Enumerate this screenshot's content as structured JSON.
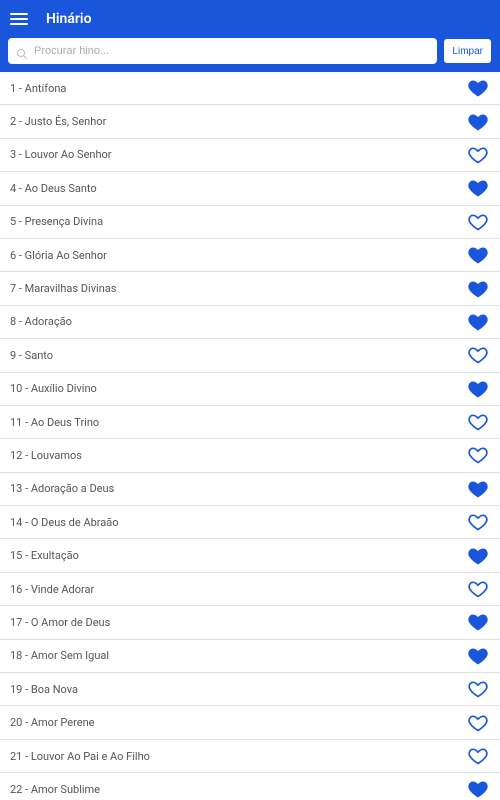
{
  "header": {
    "title": "Hinário"
  },
  "search": {
    "placeholder": "Procurar hino...",
    "clear_label": "Limpar"
  },
  "colors": {
    "primary": "#1a56db"
  },
  "hymns": [
    {
      "num": 1,
      "title": "Antífona",
      "fav": true
    },
    {
      "num": 2,
      "title": "Justo És, Senhor",
      "fav": true
    },
    {
      "num": 3,
      "title": "Louvor Ao Senhor",
      "fav": false
    },
    {
      "num": 4,
      "title": "Ao Deus Santo",
      "fav": true
    },
    {
      "num": 5,
      "title": "Presença Divina",
      "fav": false
    },
    {
      "num": 6,
      "title": "Glória Ao Senhor",
      "fav": true
    },
    {
      "num": 7,
      "title": "Maravilhas Divinas",
      "fav": true
    },
    {
      "num": 8,
      "title": "Adoração",
      "fav": true
    },
    {
      "num": 9,
      "title": "Santo",
      "fav": false
    },
    {
      "num": 10,
      "title": "Auxílio Divino",
      "fav": true
    },
    {
      "num": 11,
      "title": "Ao Deus Trino",
      "fav": false
    },
    {
      "num": 12,
      "title": "Louvamos",
      "fav": false
    },
    {
      "num": 13,
      "title": "Adoração a Deus",
      "fav": true
    },
    {
      "num": 14,
      "title": "O Deus de Abraão",
      "fav": false
    },
    {
      "num": 15,
      "title": "Exultação",
      "fav": true
    },
    {
      "num": 16,
      "title": "Vinde Adorar",
      "fav": false
    },
    {
      "num": 17,
      "title": "O Amor de Deus",
      "fav": true
    },
    {
      "num": 18,
      "title": "Amor Sem Igual",
      "fav": true
    },
    {
      "num": 19,
      "title": "Boa Nova",
      "fav": false
    },
    {
      "num": 20,
      "title": "Amor Perene",
      "fav": false
    },
    {
      "num": 21,
      "title": "Louvor Ao Pai e Ao Filho",
      "fav": false
    },
    {
      "num": 22,
      "title": "Amor Sublime",
      "fav": true
    }
  ]
}
